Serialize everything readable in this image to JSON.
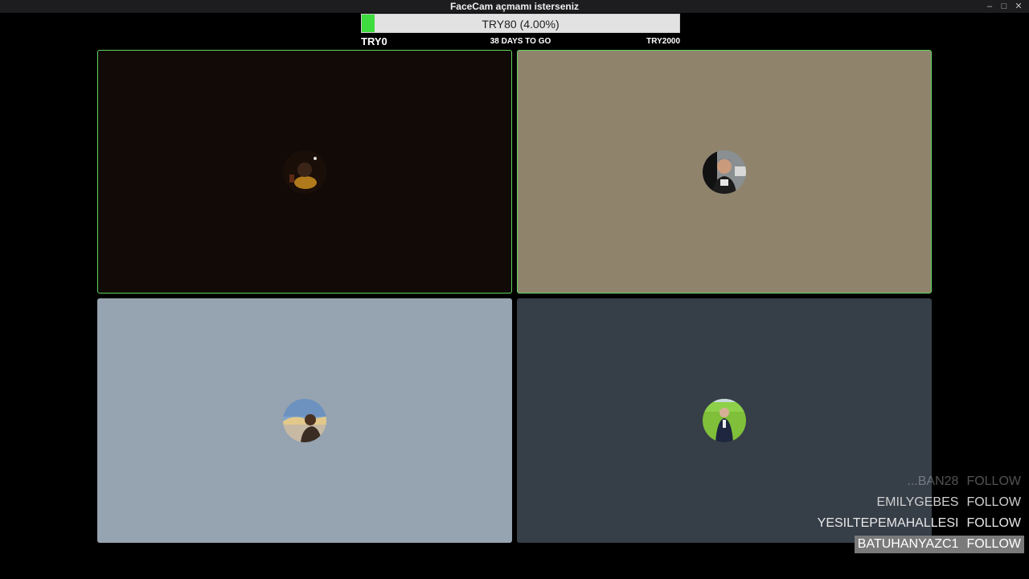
{
  "window": {
    "title": "FaceCam açmamı isterseniz",
    "minimize_glyph": "–",
    "maximize_glyph": "□",
    "close_glyph": "✕"
  },
  "goal": {
    "label": "TRY80 (4.00%)",
    "progress_percent": 4.0,
    "min_label": "TRY0",
    "days_left": "38 DAYS TO GO",
    "max_label": "TRY2000",
    "fill_color": "#3fdc3f"
  },
  "tiles": [
    {
      "name": "participant-1",
      "active": true,
      "background": "#120a06",
      "avatar": "avatar-night-icon"
    },
    {
      "name": "participant-2",
      "active": true,
      "background": "#8f836c",
      "avatar": "avatar-man-icon"
    },
    {
      "name": "participant-3",
      "active": false,
      "background": "#96a3b0",
      "avatar": "avatar-landscape-icon"
    },
    {
      "name": "participant-4",
      "active": false,
      "background": "#363e48",
      "avatar": "avatar-field-icon"
    }
  ],
  "follow_alerts": [
    {
      "user": "...BAN28",
      "action": "FOLLOW"
    },
    {
      "user": "EMILYGEBES",
      "action": "FOLLOW"
    },
    {
      "user": "YESILTEPEMAHALLESI",
      "action": "FOLLOW"
    },
    {
      "user": "BATUHANYAZC1",
      "action": "FOLLOW"
    }
  ],
  "colors": {
    "active_border": "#5fd45f",
    "highlight_row": "#7a7a7a"
  }
}
